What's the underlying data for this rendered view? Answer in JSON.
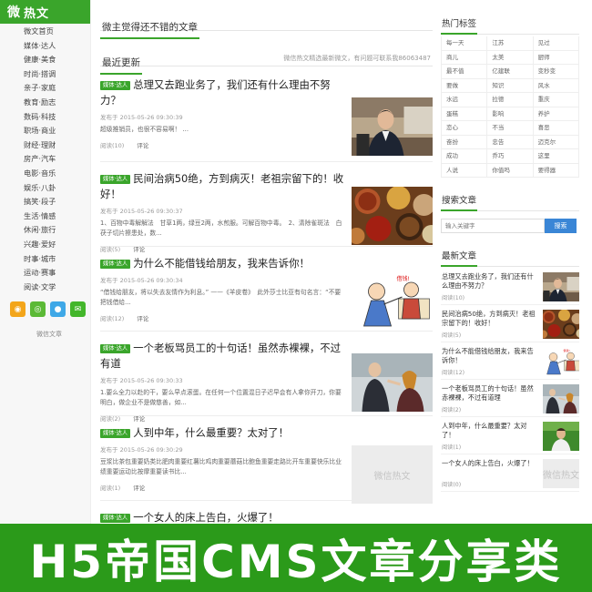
{
  "logo": {
    "text": "热文",
    "mark": "微"
  },
  "nav": [
    "微文首页",
    "媒体·达人",
    "健康·美食",
    "时尚·搭调",
    "亲子·家庭",
    "教育·励志",
    "数码·科技",
    "职场·商业",
    "财经·理财",
    "房产·汽车",
    "电影·音乐",
    "娱乐·八卦",
    "搞笑·段子",
    "生活·情感",
    "休闲·旅行",
    "兴趣·爱好",
    "时事·城市",
    "运动·赛事",
    "阅读·文学"
  ],
  "sidebar_caption": "微信文章",
  "main": {
    "featured_title": "微主觉得还不错的文章",
    "latest_title": "最近更新",
    "latest_note": "微信热文精选最新微文，有问题可联系我86063487",
    "articles": [
      {
        "tag": "媒体·达人",
        "title": "总理又去跑业务了，我们还有什么理由不努力？",
        "date": "发布于 2015-05-26 09:30:39",
        "excerpt": "超级推销员，也很不容易啊！ ...",
        "views": "阅读(10)",
        "comment": "评论",
        "image": "premier-photo"
      },
      {
        "tag": "媒体·达人",
        "title": "民间治病50绝，方到病灭！老祖宗留下的！收好！",
        "date": "发布于 2015-05-26 09:30:37",
        "excerpt": "1、百物中毒解解法　甘草1两，绿豆2两，水煎服。可解百物中毒。　2、清除雀斑法　白茯子切片擦患处，数...",
        "views": "阅读(5)",
        "comment": "评论",
        "image": "herbs-photo"
      },
      {
        "tag": "媒体·达人",
        "title": "为什么不能借钱给朋友，我来告诉你！",
        "date": "发布于 2015-05-26 09:30:34",
        "excerpt": "“借钱给朋友，将以失去友情作为利息。” ——《羊皮卷》　此外莎士比亚有句名言：“不要把钱借给...",
        "views": "阅读(12)",
        "comment": "评论",
        "image": "cartoon-photo"
      },
      {
        "tag": "媒体·达人",
        "title": "一个老板骂员工的十句话！虽然赤裸裸，不过有道",
        "date": "发布于 2015-05-26 09:30:33",
        "excerpt": "1.要么全力以赴的干，要么早点滚蛋。在任何一个位置混日子迟早会有人拿你开刀，你要明白，做企业不是做慈善，如...",
        "views": "阅读(2)",
        "comment": "评论",
        "image": "boss-photo"
      },
      {
        "tag": "媒体·达人",
        "title": "人到中年，什么最重要？太对了！",
        "date": "发布于 2015-05-26 09:30:29",
        "excerpt": "豆浆比茶包重要奶类比肥肉重要红薯比鸡肉重要蘑菇比鲍鱼重要走路比开车重要快乐比业绩重要运动比按摩重要读书比...",
        "views": "阅读(1)",
        "comment": "评论",
        "image": "placeholder",
        "placeholder_text": "微信热文"
      },
      {
        "tag": "媒体·达人",
        "title": "一个女人的床上告白，火爆了！"
      }
    ]
  },
  "right": {
    "hot_tags_title": "热门标签",
    "hot_tags": [
      "每一天",
      "江苏",
      "见过",
      "商儿",
      "太美",
      "厨师",
      "最不值",
      "亿建联",
      "变秒变",
      "要做",
      "知识",
      "风水",
      "水远",
      "拉德",
      "重庆",
      "蛋糕",
      "影响",
      "养护",
      "恋心",
      "不当",
      "喜恶",
      "奋扮",
      "忠告",
      "迈克尔",
      "成功",
      "乔巧",
      "这里",
      "人说",
      "你值吗",
      "要得器"
    ],
    "search_title": "搜索文章",
    "search_placeholder": "输入关键字",
    "search_button": "搜索",
    "latest_title": "最新文章",
    "latest": [
      {
        "title": "总理又去跑业务了，我们还有什么理由不努力？",
        "views": "阅读(10)",
        "image": "premier-photo"
      },
      {
        "title": "民间治病50绝，方到病灭！老祖宗留下的！收好！",
        "views": "阅读(5)",
        "image": "herbs-photo"
      },
      {
        "title": "为什么不能借钱给朋友，我来告诉你！",
        "views": "阅读(12)",
        "image": "cartoon-photo"
      },
      {
        "title": "一个老板骂员工的十句话！虽然赤裸裸，不过有道理",
        "views": "阅读(2)",
        "image": "boss-photo"
      },
      {
        "title": "人到中年，什么最重要？太对了！",
        "views": "阅读(1)",
        "image": "man-photo"
      },
      {
        "title": "一个女人的床上告白，火爆了！",
        "views": "阅读(0)",
        "image": "placeholder",
        "placeholder_text": "微信热文"
      }
    ]
  },
  "banner": {
    "text": "H5帝国CMS文章分享类"
  },
  "colors": {
    "brand_green": "#3aa52b",
    "banner_green": "#2b9a1a",
    "search_blue": "#3a86d6"
  }
}
